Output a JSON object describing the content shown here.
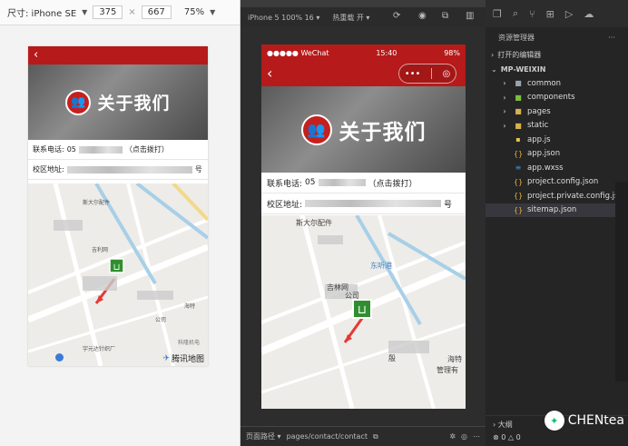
{
  "left": {
    "size_label": "尺寸: iPhone SE",
    "width_value": "375",
    "times": "×",
    "height_value": "667",
    "zoom_value": "75%",
    "page": {
      "back": "‹",
      "banner_title": "关于我们",
      "phone_label": "联系电话:",
      "phone_prefix": "05",
      "phone_action": "（点击拨打）",
      "address_label": "校区地址:",
      "address_suffix": "号",
      "map_brand": "腾讯地图",
      "map_labels": [
        "斯大尔配件",
        "吉利网",
        "宇元达针织厂",
        "科隆机电",
        "海特",
        "公司"
      ]
    }
  },
  "sim": {
    "device_label": "iPhone 5 100% 16 ▾",
    "hot_reload": "热重载 开 ▾",
    "status": {
      "carrier": "●●●●● WeChat",
      "time": "15:40",
      "battery": "98%"
    },
    "back": "‹",
    "capsule_dots": "•••",
    "capsule_target": "◎",
    "banner_title": "关于我们",
    "phone_label": "联系电话:",
    "phone_prefix": "05",
    "phone_action": "（点击拨打）",
    "address_label": "校区地址:",
    "address_suffix": "号",
    "map_labels": [
      "斯大尔配件",
      "东听港",
      "吉林网",
      "公司",
      "海特",
      "管理有",
      "殷"
    ],
    "bottom": {
      "path_label": "页面路径 ▾",
      "path_value": "pages/contact/contact"
    }
  },
  "explorer": {
    "title": "资源管理器",
    "more": "···",
    "open_editors": "打开的编辑器",
    "project": "MP-WEIXIN",
    "items": [
      {
        "name": "common",
        "type": "folder"
      },
      {
        "name": "components",
        "type": "folder"
      },
      {
        "name": "pages",
        "type": "folder"
      },
      {
        "name": "static",
        "type": "folder"
      },
      {
        "name": "app.js",
        "type": "js"
      },
      {
        "name": "app.json",
        "type": "json"
      },
      {
        "name": "app.wxss",
        "type": "wxss"
      },
      {
        "name": "project.config.json",
        "type": "json"
      },
      {
        "name": "project.private.config.js...",
        "type": "json"
      },
      {
        "name": "sitemap.json",
        "type": "json",
        "selected": true
      }
    ],
    "outline": "大纲",
    "errors": "⊗ 0 △ 0",
    "brand_name": "CHENtea"
  },
  "colors": {
    "nav": "#b61a1a",
    "folder": "#d7b14a",
    "js": "#e5c34a",
    "json": "#e8b23a",
    "wxss": "#3b8ed8",
    "map_pin": "#2f8f2f"
  }
}
